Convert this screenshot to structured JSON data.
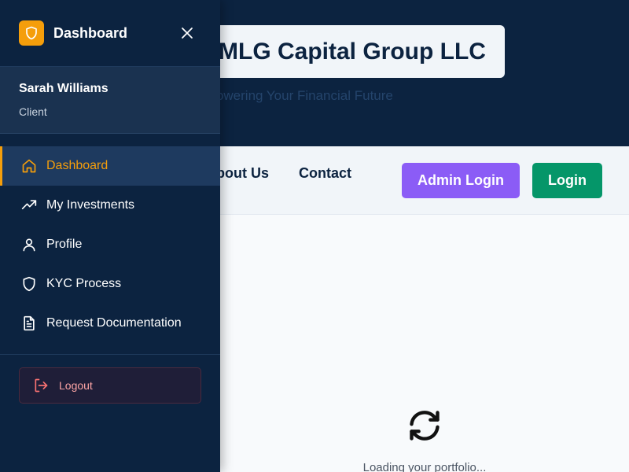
{
  "site": {
    "brand_title": "MLG Capital Group LLC",
    "tagline": "Empowering Your Financial Future",
    "nav": {
      "about_label": "About Us",
      "contact_label": "Contact"
    },
    "admin_login_label": "Admin Login",
    "login_label": "Login",
    "loading_text": "Loading your portfolio..."
  },
  "sidebar": {
    "title": "Dashboard",
    "logo_icon": "shield-icon",
    "close_icon": "close-icon",
    "user": {
      "name": "Sarah Williams",
      "role": "Client"
    },
    "items": [
      {
        "label": "Dashboard",
        "icon": "home-icon",
        "active": true
      },
      {
        "label": "My Investments",
        "icon": "trending-up-icon",
        "active": false
      },
      {
        "label": "Profile",
        "icon": "user-icon",
        "active": false
      },
      {
        "label": "KYC Process",
        "icon": "shield-icon",
        "active": false
      },
      {
        "label": "Request Documentation",
        "icon": "document-icon",
        "active": false
      }
    ],
    "logout_label": "Logout",
    "logout_icon": "logout-icon"
  },
  "colors": {
    "navy": "#0c2340",
    "accent": "#f59e0b",
    "admin_button": "#8b5cf6",
    "login_button": "#059669",
    "logout_text": "#fca5a5"
  }
}
